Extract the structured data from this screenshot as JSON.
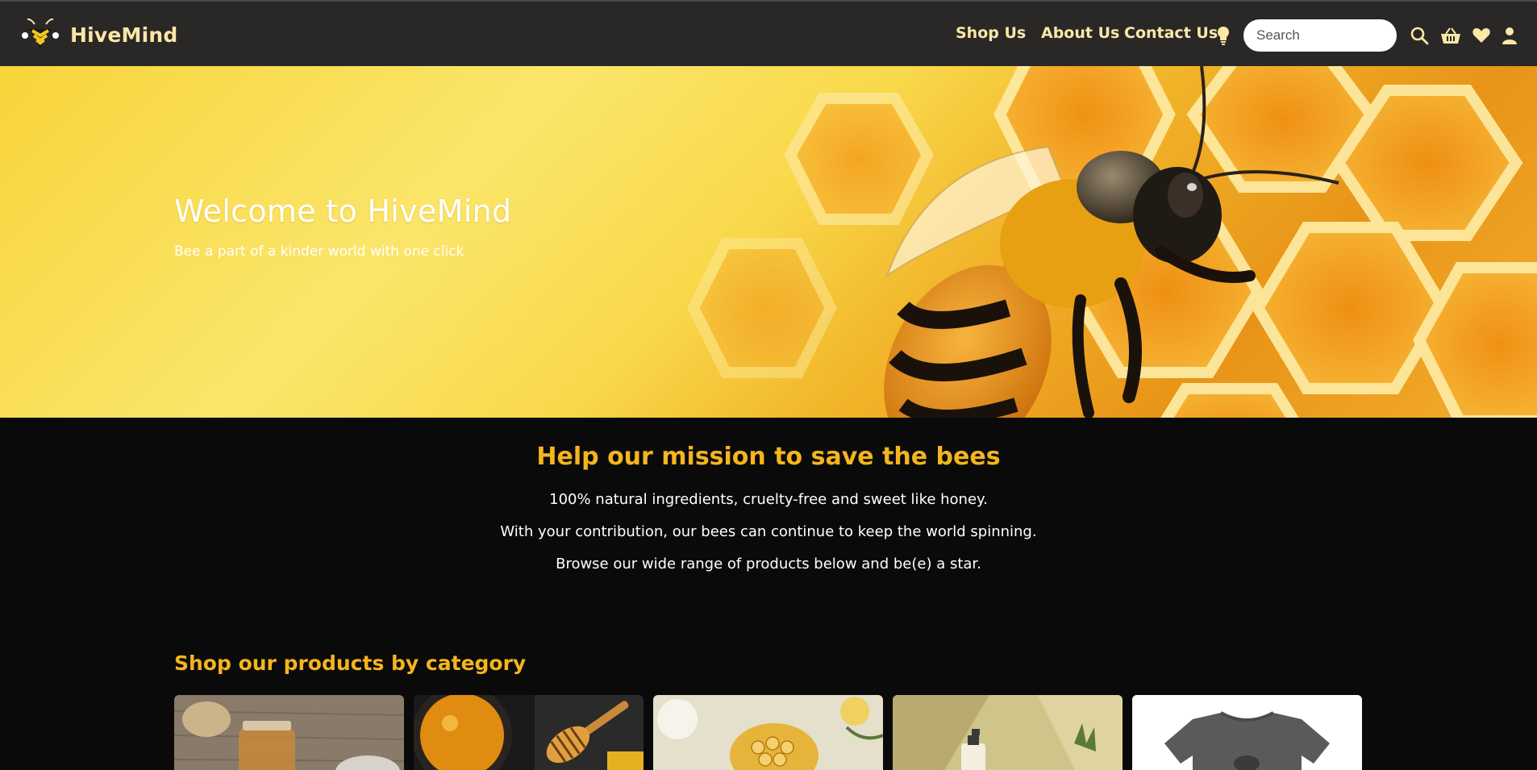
{
  "brand": {
    "name": "HiveMind",
    "logo_icon": "bee-logo-icon"
  },
  "nav": {
    "links": [
      "Shop Us",
      "About Us",
      "Contact Us"
    ],
    "search_placeholder": "Search",
    "icons": [
      "lightbulb-icon",
      "search-icon",
      "basket-icon",
      "heart-icon",
      "user-icon"
    ]
  },
  "hero": {
    "title": "Welcome to HiveMind",
    "subtitle": "Bee a part of a kinder world with one click"
  },
  "mission": {
    "title": "Help our mission to save the bees",
    "lines": [
      "100% natural ingredients, cruelty-free and sweet like honey.",
      "With your contribution, our bees can continue to keep the world spinning.",
      "Browse our wide range of products below and be(e) a star."
    ]
  },
  "categories": {
    "title": "Shop our products by category",
    "cards": [
      "honey-jar-wood",
      "honey-bowl-dipper",
      "honeycomb-flowers",
      "bath-bottle",
      "grey-tshirt"
    ]
  },
  "colors": {
    "nav_bg": "#2a2727",
    "nav_text": "#fbe7a6",
    "accent": "#f4b51d",
    "page_bg": "#0b0a0a"
  }
}
